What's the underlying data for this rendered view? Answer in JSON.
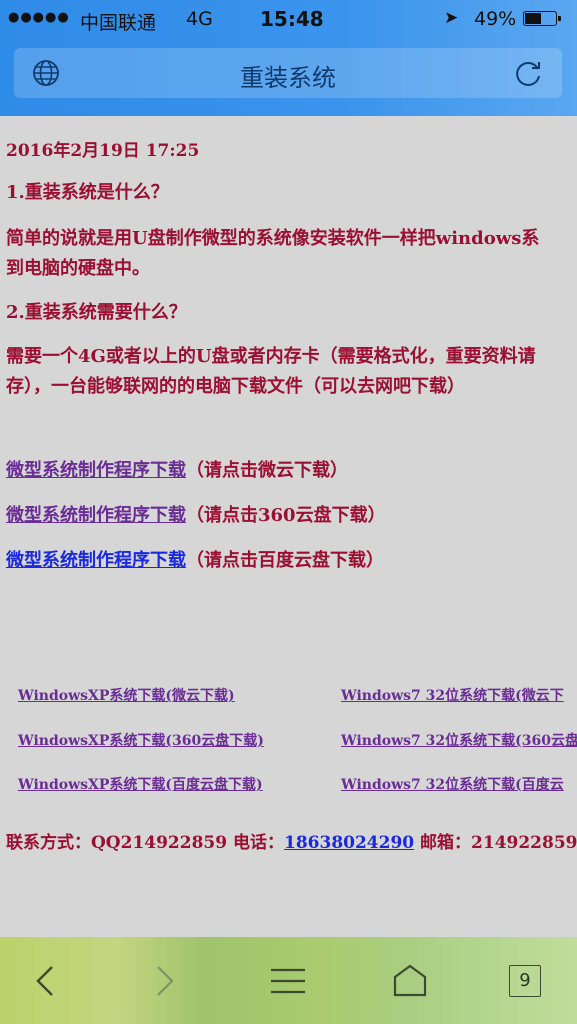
{
  "status": {
    "signal": "●●●●●",
    "carrier": "中国联通",
    "network": "4G",
    "time": "15:48",
    "battery": "49%"
  },
  "browser": {
    "page_title": "重装系统",
    "tab_count": "9"
  },
  "article": {
    "date": "2016年2月19日 17:25",
    "q1": "1.重装系统是什么？",
    "a1_line1": "简单的说就是用U盘制作微型的系统像安装软件一样把windows系",
    "a1_line2": "到电脑的硬盘中。",
    "q2": "2.重装系统需要什么？",
    "a2_line1": "需要一个4G或者以上的U盘或者内存卡（需要格式化，重要资料请",
    "a2_line2": "存），一台能够联网的的电脑下载文件（可以去网吧下载）"
  },
  "downloads": [
    {
      "link": "微型系统制作程序下载",
      "note": "（请点击微云下载）"
    },
    {
      "link": "微型系统制作程序下载",
      "note": "（请点击360云盘下载）"
    },
    {
      "link": "微型系统制作程序下载",
      "note": "（请点击百度云盘下载）"
    }
  ],
  "system_links": {
    "xp": [
      "WindowsXP系统下载(微云下载)",
      "WindowsXP系统下载(360云盘下载)",
      "WindowsXP系统下载(百度云盘下载)"
    ],
    "win7": [
      "Windows7 32位系统下载(微云下",
      "Windows7 32位系统下载(360云盘",
      "Windows7 32位系统下载(百度云"
    ]
  },
  "contact": {
    "label": "联系方式：QQ214922859 电话：",
    "phone": "18638024290",
    "email_label": " 邮箱：214922859@"
  },
  "colors": {
    "header_blue": "#2f8be8",
    "text_red": "#9b1032",
    "link_purple": "#6a2c95",
    "link_blue": "#1a29e0"
  }
}
